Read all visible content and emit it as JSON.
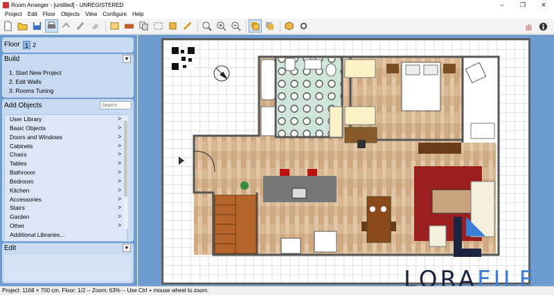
{
  "window": {
    "title": "Room Arranger - [untitled] - UNREGISTERED",
    "controls": [
      "–",
      "❐",
      "✕"
    ]
  },
  "menu": [
    "Project",
    "Edit",
    "Floor",
    "Objects",
    "View",
    "Configure",
    "Help"
  ],
  "floor": {
    "label": "Floor",
    "tabs": [
      "1",
      "2"
    ],
    "selected": "1"
  },
  "build": {
    "label": "Build",
    "items": [
      "1. Start New Project",
      "2. Edit Walls",
      "3. Rooms Tuning"
    ]
  },
  "add_objects": {
    "label": "Add Objects",
    "search_placeholder": "Search",
    "items": [
      "User Library",
      "Basic Objects",
      "Doors and Windows",
      "Cabinets",
      "Chairs",
      "Tables",
      "Bathroom",
      "Bedroom",
      "Kitchen",
      "Accessories",
      "Stairs",
      "Garden",
      "Other"
    ],
    "more": "Additional Libraries..."
  },
  "edit": {
    "label": "Edit"
  },
  "status": "Project: 1168 × 700 cm, Floor: 1/2 -- Zoom: 63% -- Use Ctrl + mouse wheel to zoom.",
  "watermark": {
    "left": "LORA",
    "right": "FILE"
  },
  "colors": {
    "panel": "#6e9bd0",
    "section": "#c8daf2",
    "accent": "#3b7fd6"
  }
}
